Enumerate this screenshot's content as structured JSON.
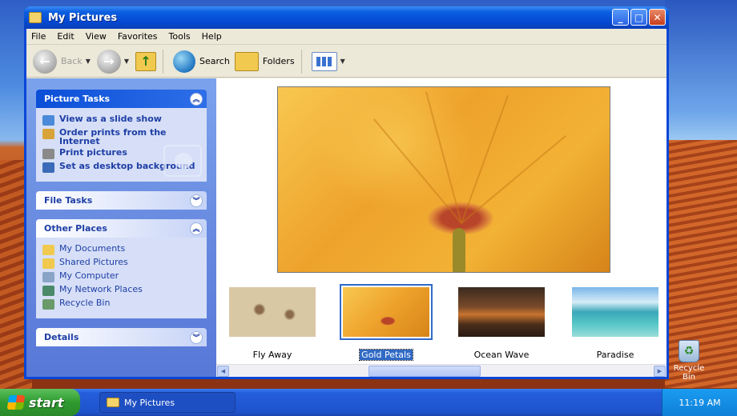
{
  "window": {
    "title": "My Pictures"
  },
  "menu": [
    "File",
    "Edit",
    "View",
    "Favorites",
    "Tools",
    "Help"
  ],
  "toolbar": {
    "back": "Back",
    "search": "Search",
    "folders": "Folders"
  },
  "picture_tasks": {
    "title": "Picture Tasks",
    "items": [
      "View as a slide show",
      "Order prints from the Internet",
      "Print pictures",
      "Set as desktop background"
    ]
  },
  "file_tasks": {
    "title": "File Tasks"
  },
  "other_places": {
    "title": "Other Places",
    "items": [
      "My Documents",
      "Shared Pictures",
      "My Computer",
      "My Network Places",
      "Recycle Bin"
    ]
  },
  "details": {
    "title": "Details"
  },
  "thumbnails": [
    {
      "label": "Fly Away",
      "selected": false
    },
    {
      "label": "Gold Petals",
      "selected": true
    },
    {
      "label": "Ocean Wave",
      "selected": false
    },
    {
      "label": "Paradise",
      "selected": false
    }
  ],
  "desktop": {
    "recycle_bin": "Recycle Bin"
  },
  "taskbar": {
    "start": "start",
    "task": "My Pictures",
    "clock": "11:19 AM"
  },
  "colors": {
    "accent": "#0a46d6",
    "selection": "#316ac5",
    "task_link": "#1e3ea5"
  }
}
